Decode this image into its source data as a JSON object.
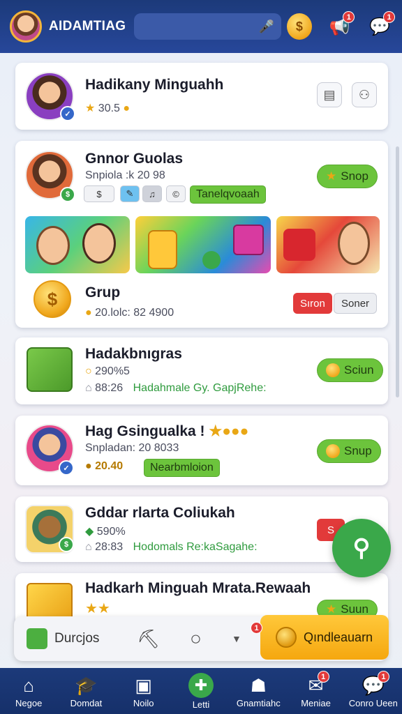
{
  "header": {
    "app_title": "AIDAMTIAG",
    "search_placeholder": "",
    "coin_symbol": "$",
    "notification_badge": "1",
    "message_badge": "1"
  },
  "cards": [
    {
      "title": "Hadikany Minguahh",
      "stat": "30.5",
      "icons": [
        "inbox-icon",
        "user-icon"
      ]
    },
    {
      "title": "Gnnor Guolas",
      "subtitle": "Snpiola :k 20 98",
      "tag": "Tanelqvoaah",
      "button": "Snop",
      "chips": [
        "$",
        "✎",
        "♫",
        "©"
      ],
      "thumbnails": [
        "kids-scene",
        "coins-gifts-scene",
        "reading-scene"
      ]
    },
    {
      "title": "Grup",
      "subtitle": "20.lolc: 82 4900",
      "btn_primary": "Sıron",
      "btn_secondary": "Soner"
    },
    {
      "title": "Hadakbnıgras",
      "line1": "290%5",
      "line2": "88:26",
      "link": "Hadahmale Gy. GapjRehe:",
      "button": "Sciun"
    },
    {
      "title": "Hag Gsingualka !",
      "subtitle": "Snpladan: 20 8033",
      "stat": "20.40",
      "tag": "Nearbmloion",
      "button": "Snup"
    },
    {
      "title": "Gddar rlarta Coliukah",
      "line1": "590%",
      "line2": "28:83",
      "link": "Hodomals Re:kaSagahe:",
      "button": "S"
    },
    {
      "title": "Hadkarh Minguah Mrata.Rewaah",
      "button": "Suun"
    }
  ],
  "bottom_panel": {
    "left_label": "Durcjos",
    "cta_label": "Qındleauarn",
    "cta_badge": "1"
  },
  "nav": [
    {
      "label": "Negoe",
      "icon": "home-icon",
      "glyph": "⌂"
    },
    {
      "label": "Domdat",
      "icon": "graduation-cap-icon",
      "glyph": "🎓"
    },
    {
      "label": "Noilo",
      "icon": "tv-icon",
      "glyph": "▣"
    },
    {
      "label": "Letti",
      "icon": "plus-icon",
      "glyph": "✚"
    },
    {
      "label": "Gnamtiahc",
      "icon": "robot-icon",
      "glyph": "☗"
    },
    {
      "label": "Meniae",
      "icon": "message-icon",
      "glyph": "✉",
      "badge": "1"
    },
    {
      "label": "Conro Ueen",
      "icon": "chat-bubble-icon",
      "glyph": "💬",
      "badge": "1"
    }
  ],
  "colors": {
    "header_bg": "#1c3a7a",
    "accent_green": "#6cc43c",
    "accent_gold": "#f5a70f",
    "alert_red": "#e23a3a"
  }
}
